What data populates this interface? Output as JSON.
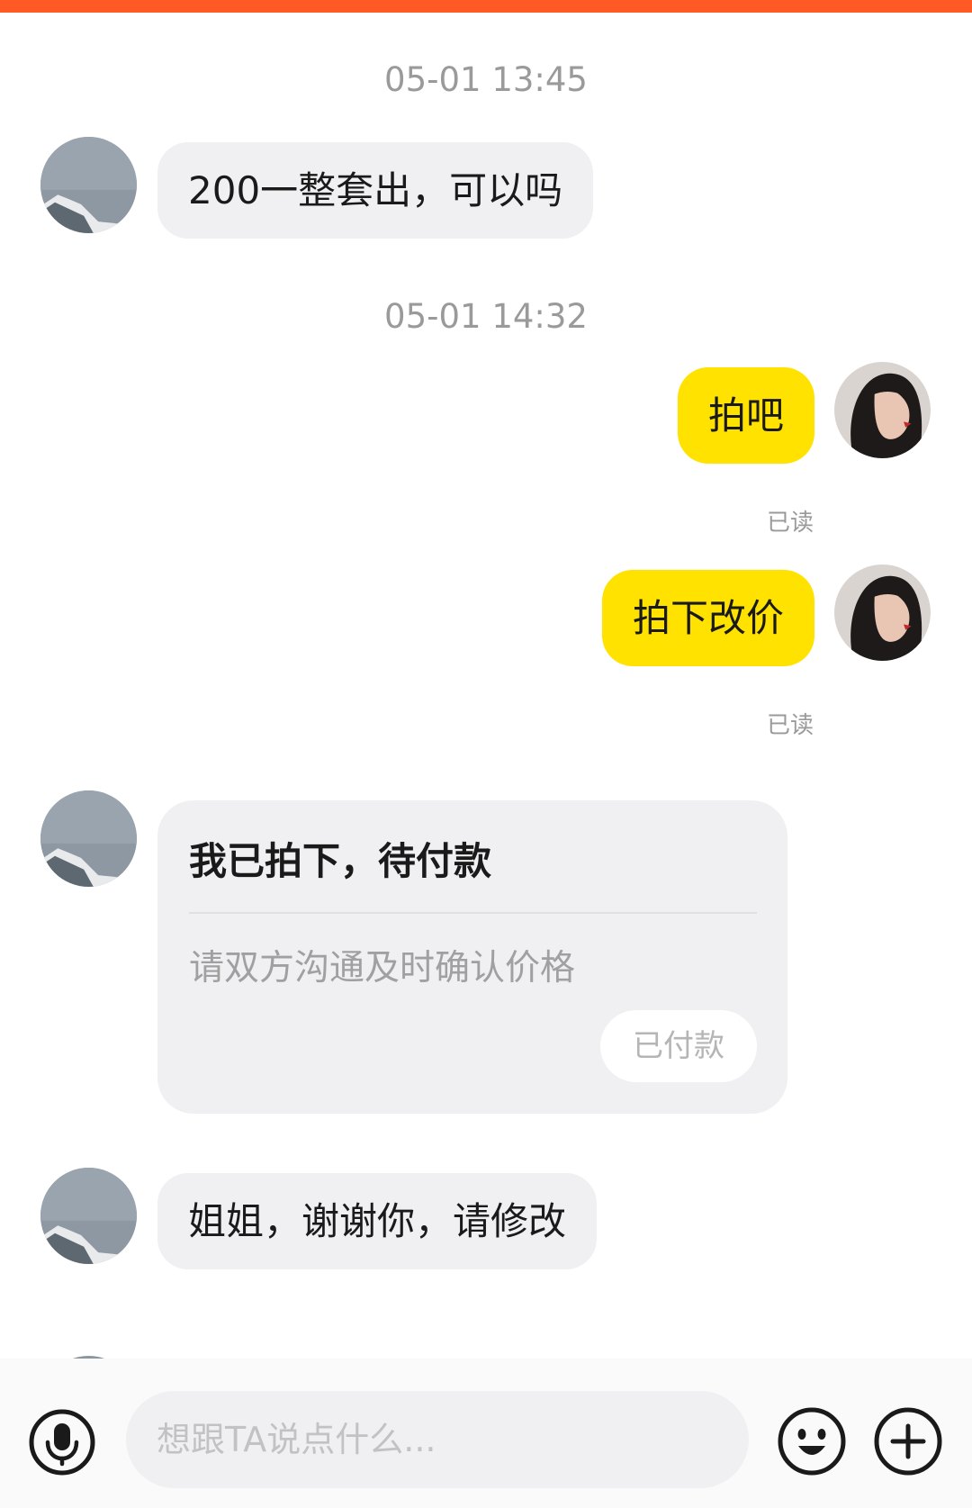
{
  "theme": {
    "accent": "#ff5a26",
    "outgoing_bubble": "#ffe200",
    "incoming_bubble": "#f0f0f2"
  },
  "messages": {
    "ts1": "05-01 13:45",
    "m1": "200一整套出，可以吗",
    "ts2": "05-01 14:32",
    "m2": "拍吧",
    "m2_status": "已读",
    "m3": "拍下改价",
    "m3_status": "已读",
    "card": {
      "title": "我已拍下，待付款",
      "desc": "请双方沟通及时确认价格",
      "button": "已付款"
    },
    "m4": "姐姐，谢谢你，请修改"
  },
  "input": {
    "placeholder": "想跟TA说点什么...",
    "value": ""
  },
  "icons": {
    "voice": "microphone-icon",
    "emoji": "smile-icon",
    "more": "plus-icon"
  }
}
